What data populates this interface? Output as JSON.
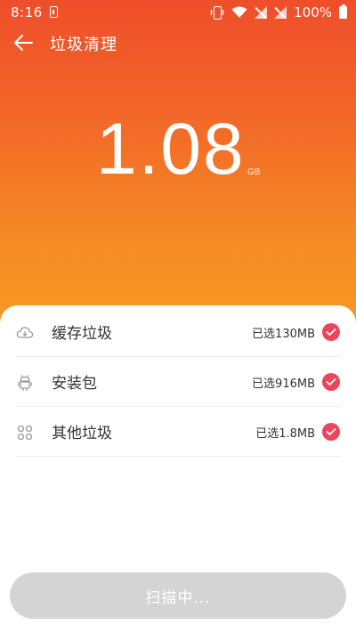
{
  "status_bar": {
    "time": "8:16",
    "battery_percent": "100%"
  },
  "header": {
    "title": "垃圾清理"
  },
  "summary": {
    "size_value": "1.08",
    "size_unit": "GB"
  },
  "categories": [
    {
      "label": "缓存垃圾",
      "selected": "已选130MB",
      "icon": "cloud-download-icon",
      "checked": true
    },
    {
      "label": "安装包",
      "selected": "已选916MB",
      "icon": "android-icon",
      "checked": true
    },
    {
      "label": "其他垃圾",
      "selected": "已选1.8MB",
      "icon": "grid-icon",
      "checked": true
    }
  ],
  "action": {
    "button_label": "扫描中..."
  },
  "colors": {
    "hero_top": "#ef4e2a",
    "hero_bottom": "#f79a23",
    "check": "#e8475c",
    "button_disabled": "#d4d4d4"
  }
}
